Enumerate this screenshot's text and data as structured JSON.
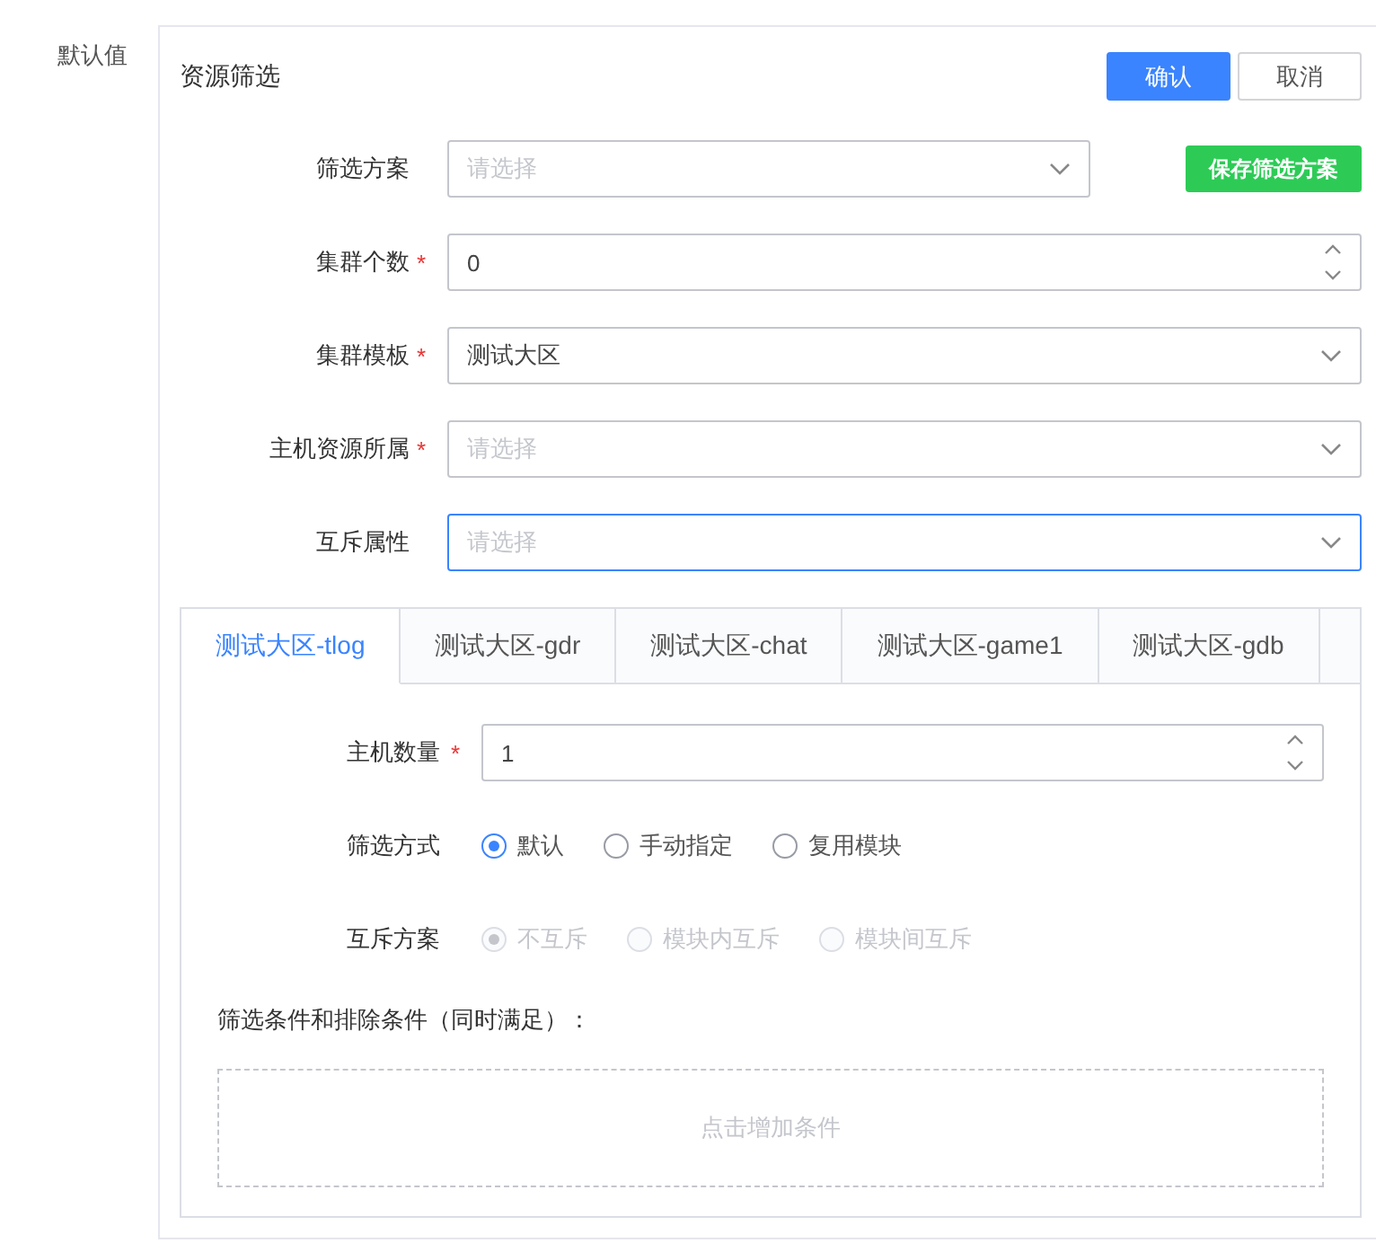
{
  "side_label": "默认值",
  "panel": {
    "title": "资源筛选",
    "confirm": "确认",
    "cancel": "取消"
  },
  "save_scheme": "保存筛选方案",
  "required_mark": "*",
  "fields": [
    {
      "label": "筛选方案",
      "required": false,
      "kind": "select",
      "placeholder": "请选择",
      "focused": false
    },
    {
      "label": "集群个数",
      "required": true,
      "kind": "number",
      "value": "0",
      "focused": false
    },
    {
      "label": "集群模板",
      "required": true,
      "kind": "select",
      "value": "测试大区",
      "focused": false
    },
    {
      "label": "主机资源所属",
      "required": true,
      "kind": "select",
      "placeholder": "请选择",
      "focused": false
    },
    {
      "label": "互斥属性",
      "required": false,
      "kind": "select",
      "placeholder": "请选择",
      "focused": true
    }
  ],
  "tabs": [
    {
      "label": "测试大区-tlog",
      "selected": true
    },
    {
      "label": "测试大区-gdr",
      "selected": false
    },
    {
      "label": "测试大区-chat",
      "selected": false
    },
    {
      "label": "测试大区-game1",
      "selected": false
    },
    {
      "label": "测试大区-gdb",
      "selected": false
    }
  ],
  "host_count": {
    "label": "主机数量",
    "required": true,
    "value": "1"
  },
  "radio_groups": [
    {
      "label": "筛选方式",
      "options": [
        {
          "label": "默认",
          "selected": true,
          "disabled": false
        },
        {
          "label": "手动指定",
          "selected": false,
          "disabled": false
        },
        {
          "label": "复用模块",
          "selected": false,
          "disabled": false
        }
      ]
    },
    {
      "label": "互斥方案",
      "options": [
        {
          "label": "不互斥",
          "selected": true,
          "disabled": true
        },
        {
          "label": "模块内互斥",
          "selected": false,
          "disabled": true
        },
        {
          "label": "模块间互斥",
          "selected": false,
          "disabled": true
        }
      ]
    }
  ],
  "conditions": {
    "label": "筛选条件和排除条件（同时满足）：",
    "add": "点击增加条件"
  }
}
